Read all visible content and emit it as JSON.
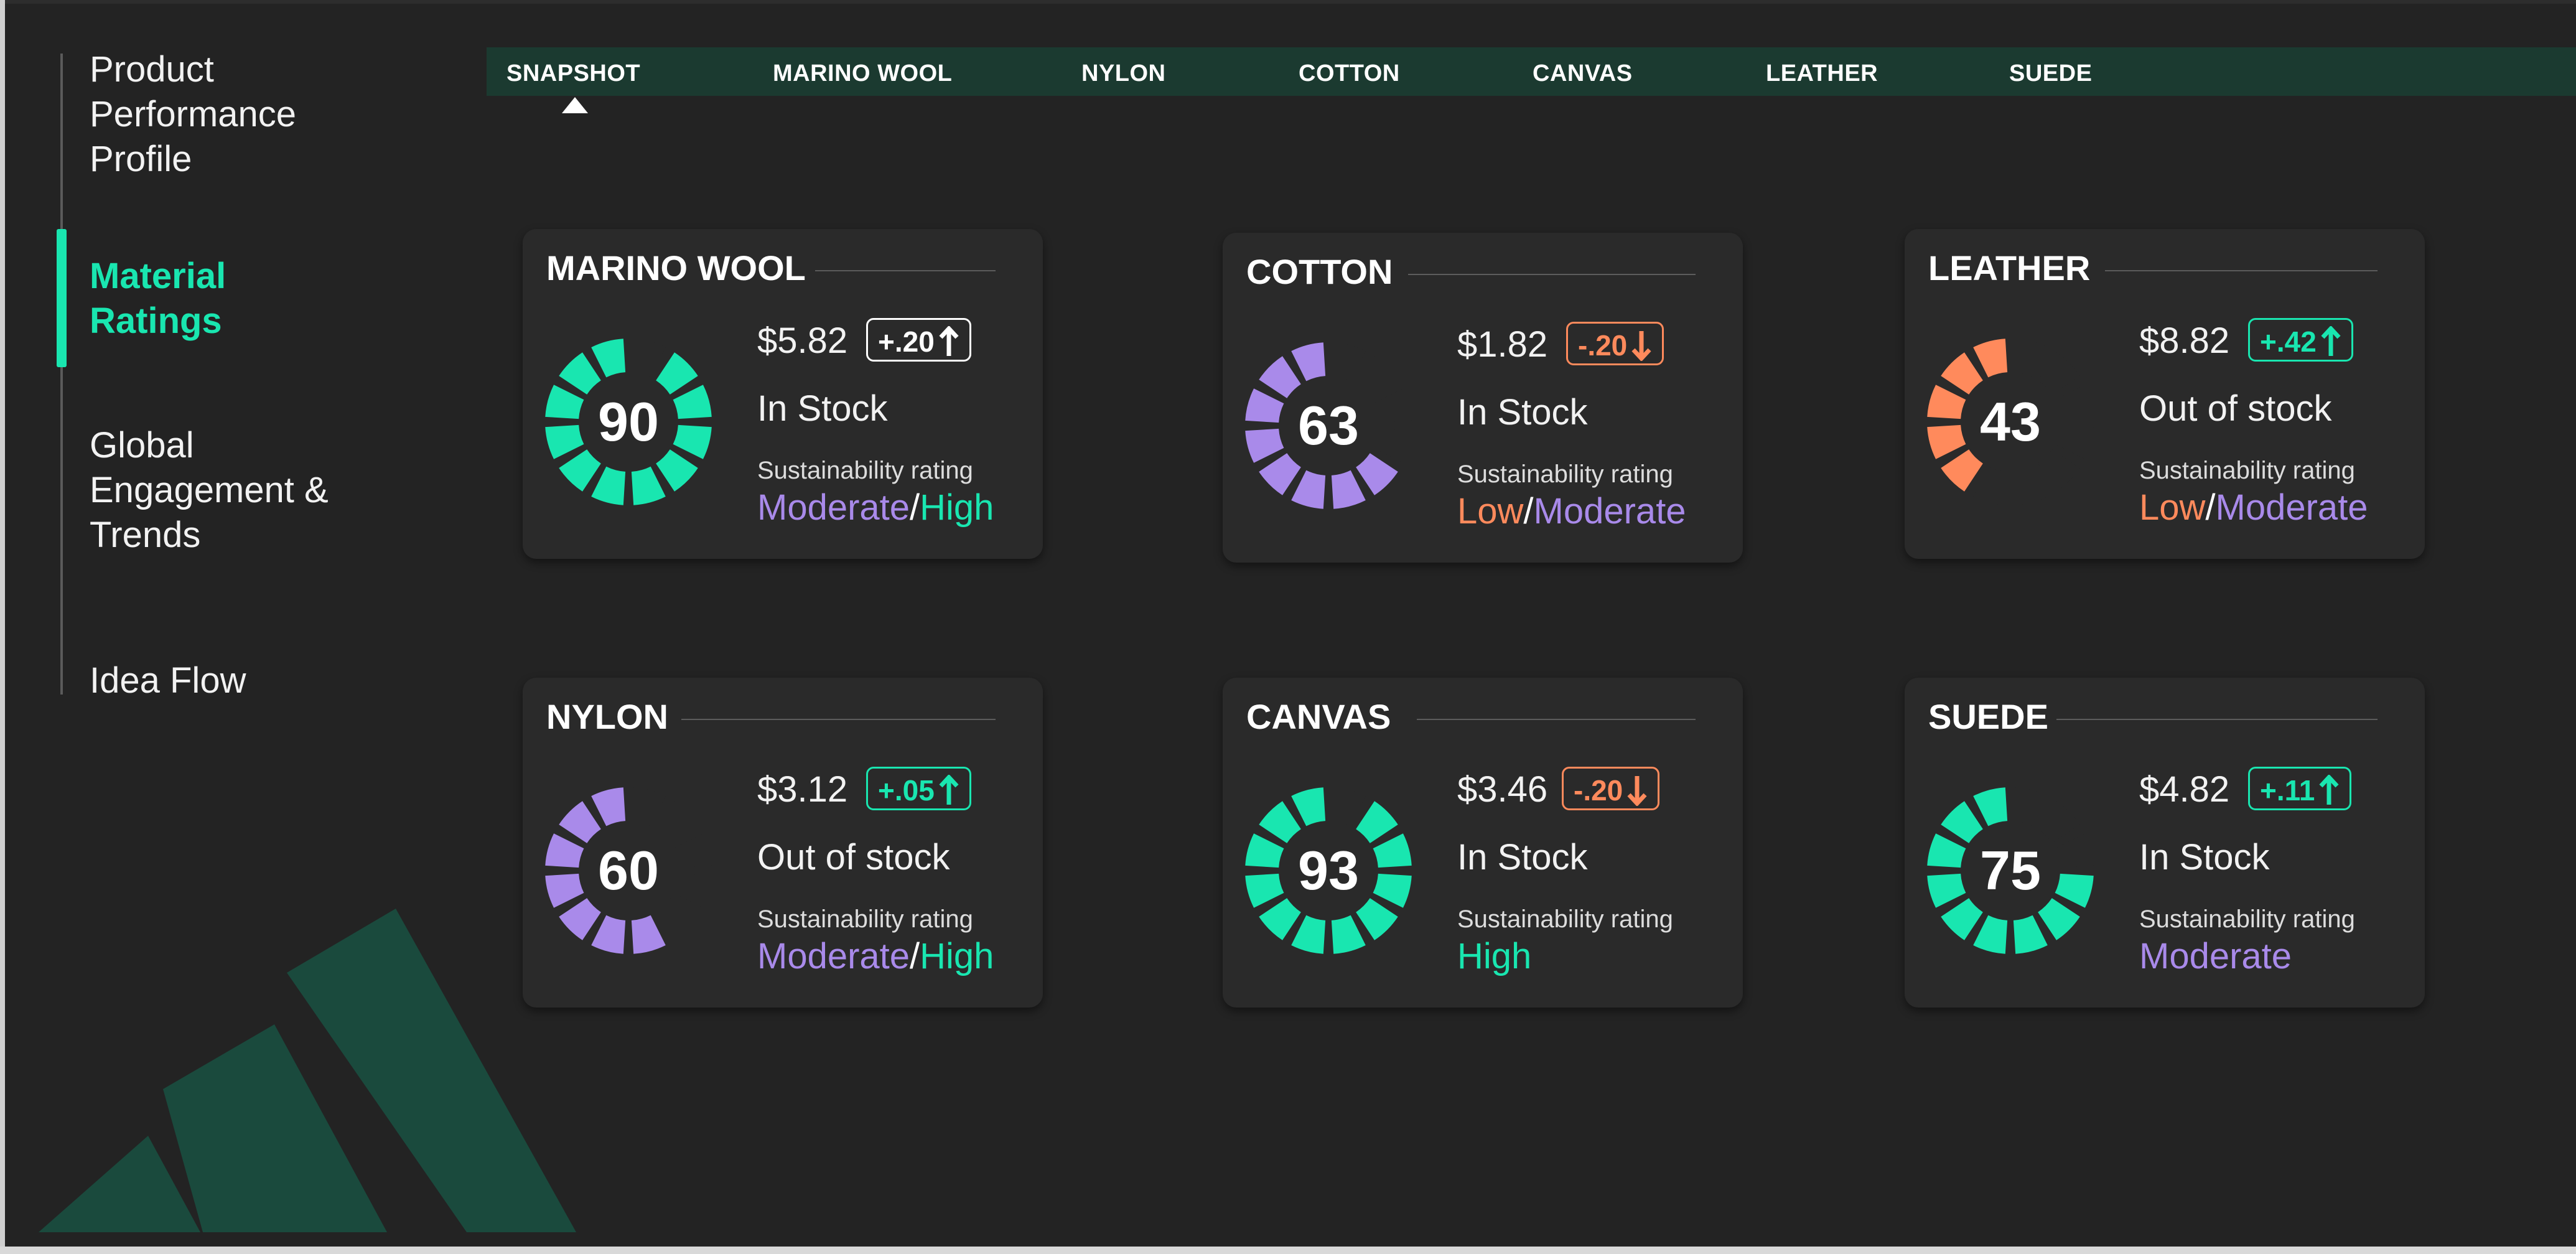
{
  "sidebar": {
    "items": [
      {
        "label": "Product Performance Profile",
        "active": false
      },
      {
        "label": "Material Ratings",
        "active": true
      },
      {
        "label": "Global Engagement & Trends",
        "active": false
      },
      {
        "label": "Idea Flow",
        "active": false
      }
    ]
  },
  "tabs": [
    {
      "label": "SNAPSHOT",
      "active": true
    },
    {
      "label": "MARINO WOOL",
      "active": false
    },
    {
      "label": "NYLON",
      "active": false
    },
    {
      "label": "COTTON",
      "active": false
    },
    {
      "label": "CANVAS",
      "active": false
    },
    {
      "label": "LEATHER",
      "active": false
    },
    {
      "label": "SUEDE",
      "active": false
    }
  ],
  "colors": {
    "accent": "#19e6b0",
    "moderate": "#a98aea",
    "low": "#ff8a5c",
    "background": "#232323",
    "card": "#2a2a2a",
    "tabbar": "#1b3a30",
    "gauge_track": "#2a2a2a"
  },
  "rating_label": "Sustainability rating",
  "cards": [
    {
      "title": "MARINO WOOL",
      "score": "90",
      "gauge_color": "#19e6b0",
      "price": "$5.82",
      "delta": "+.20",
      "direction": "up",
      "stock": "In Stock",
      "rating_parts": [
        {
          "text": "Moderate",
          "level": "moderate"
        },
        {
          "text": "High",
          "level": "high"
        }
      ]
    },
    {
      "title": "COTTON",
      "score": "63",
      "gauge_color": "#a98aea",
      "price": "$1.82",
      "delta": "-.20",
      "direction": "down",
      "stock": "In Stock",
      "rating_parts": [
        {
          "text": "Low",
          "level": "low"
        },
        {
          "text": "Moderate",
          "level": "moderate"
        }
      ]
    },
    {
      "title": "LEATHER",
      "score": "43",
      "gauge_color": "#ff8a5c",
      "price": "$8.82",
      "delta": "+.42",
      "direction": "up",
      "stock": "Out of stock",
      "rating_parts": [
        {
          "text": "Low",
          "level": "low"
        },
        {
          "text": "Moderate",
          "level": "moderate"
        }
      ]
    },
    {
      "title": "NYLON",
      "score": "60",
      "gauge_color": "#a98aea",
      "price": "$3.12",
      "delta": "+.05",
      "direction": "up",
      "stock": "Out of stock",
      "rating_parts": [
        {
          "text": "Moderate",
          "level": "moderate"
        },
        {
          "text": "High",
          "level": "high"
        }
      ]
    },
    {
      "title": "CANVAS",
      "score": "93",
      "gauge_color": "#19e6b0",
      "price": "$3.46",
      "delta": "-.20",
      "direction": "down",
      "stock": "In Stock",
      "rating_parts": [
        {
          "text": "High",
          "level": "high"
        }
      ]
    },
    {
      "title": "SUEDE",
      "score": "75",
      "gauge_color": "#19e6b0",
      "price": "$4.82",
      "delta": "+.11",
      "direction": "up",
      "stock": "In Stock",
      "rating_parts": [
        {
          "text": "Moderate",
          "level": "moderate"
        }
      ]
    }
  ]
}
